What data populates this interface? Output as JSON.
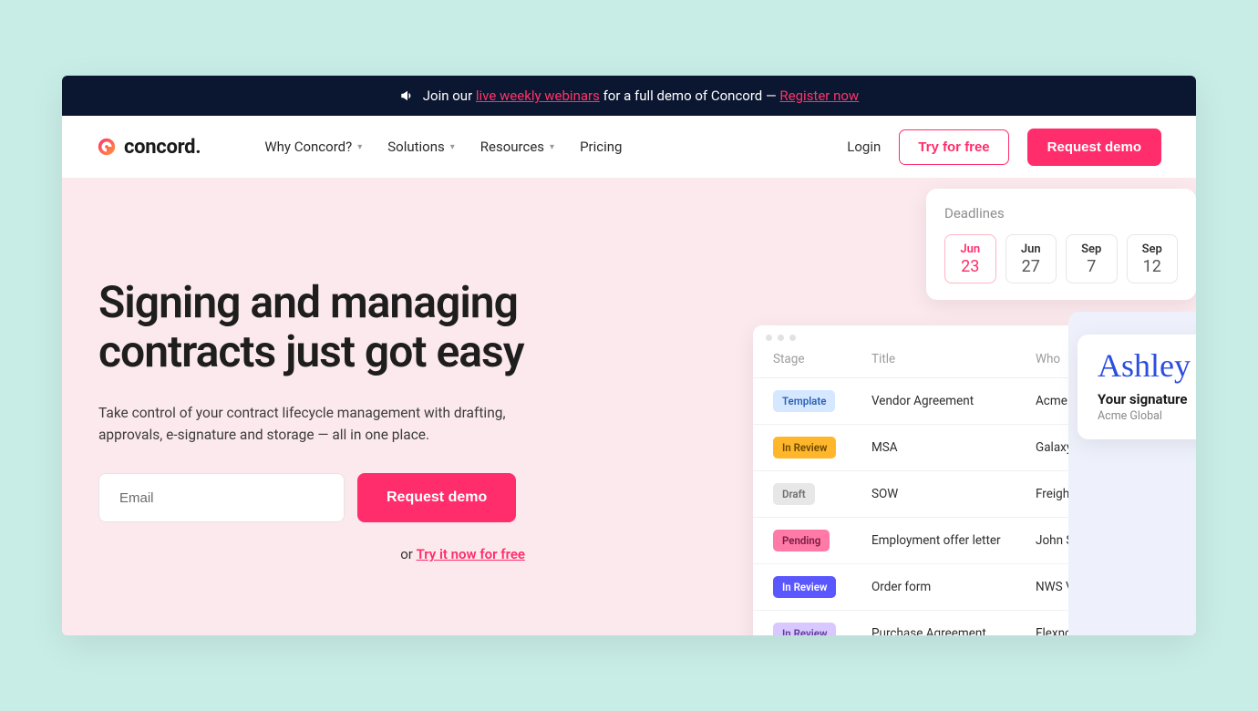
{
  "banner": {
    "prefix": "Join our ",
    "link1": "live weekly webinars",
    "middle": " for a full demo of Concord — ",
    "link2": "Register now"
  },
  "brand": {
    "name": "concord."
  },
  "nav": {
    "items": [
      {
        "label": "Why Concord?",
        "has_dropdown": true
      },
      {
        "label": "Solutions",
        "has_dropdown": true
      },
      {
        "label": "Resources",
        "has_dropdown": true
      },
      {
        "label": "Pricing",
        "has_dropdown": false
      }
    ],
    "login": "Login",
    "try_free": "Try for free",
    "request_demo": "Request demo"
  },
  "hero": {
    "title": "Signing and managing contracts just got easy",
    "subtitle": "Take control of your contract lifecycle management with drafting, approvals, e-signature and storage — all in one place.",
    "email_placeholder": "Email",
    "demo_button": "Request demo",
    "try_prefix": "or ",
    "try_link": "Try it now for free"
  },
  "deadlines": {
    "title": "Deadlines",
    "dates": [
      {
        "month": "Jun",
        "day": "23",
        "active": true
      },
      {
        "month": "Jun",
        "day": "27",
        "active": false
      },
      {
        "month": "Sep",
        "day": "7",
        "active": false
      },
      {
        "month": "Sep",
        "day": "12",
        "active": false
      }
    ]
  },
  "signature": {
    "script": "Ashley",
    "label": "Your signature",
    "company": "Acme Global"
  },
  "table": {
    "columns": {
      "stage": "Stage",
      "title": "Title",
      "who": "Who"
    },
    "rows": [
      {
        "stage": "Template",
        "badge_bg": "#d6e8ff",
        "badge_fg": "#2c62b8",
        "title": "Vendor Agreement",
        "who": "Acme Global"
      },
      {
        "stage": "In Review",
        "badge_bg": "#ffb62b",
        "badge_fg": "#6b4a00",
        "title": "MSA",
        "who": "Galaxy Corp"
      },
      {
        "stage": "Draft",
        "badge_bg": "#e7e7e7",
        "badge_fg": "#6f6f6f",
        "title": "SOW",
        "who": "Freight Unlimited"
      },
      {
        "stage": "Pending",
        "badge_bg": "#ff7aa6",
        "badge_fg": "#7a1b43",
        "title": "Employment offer letter",
        "who": "John Smith"
      },
      {
        "stage": "In Review",
        "badge_bg": "#5a57ff",
        "badge_fg": "#ffffff",
        "title": "Order form",
        "who": "NWS Ventures"
      },
      {
        "stage": "In Review",
        "badge_bg": "#d9c8ff",
        "badge_fg": "#5c3e99",
        "title": "Purchase Agreement",
        "who": "Flexnorth"
      }
    ]
  }
}
